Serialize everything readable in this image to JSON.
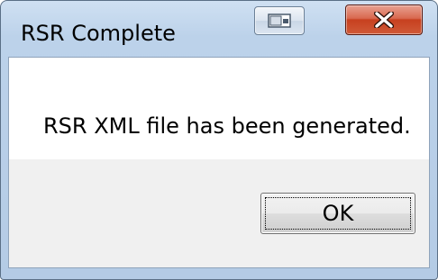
{
  "window": {
    "title": "RSR Complete",
    "controls": {
      "restore_icon": "restore-icon",
      "close_icon": "close-icon",
      "close_color": "#c7401f"
    }
  },
  "dialog": {
    "message": "RSR XML file has been generated.",
    "ok_label": "OK"
  }
}
